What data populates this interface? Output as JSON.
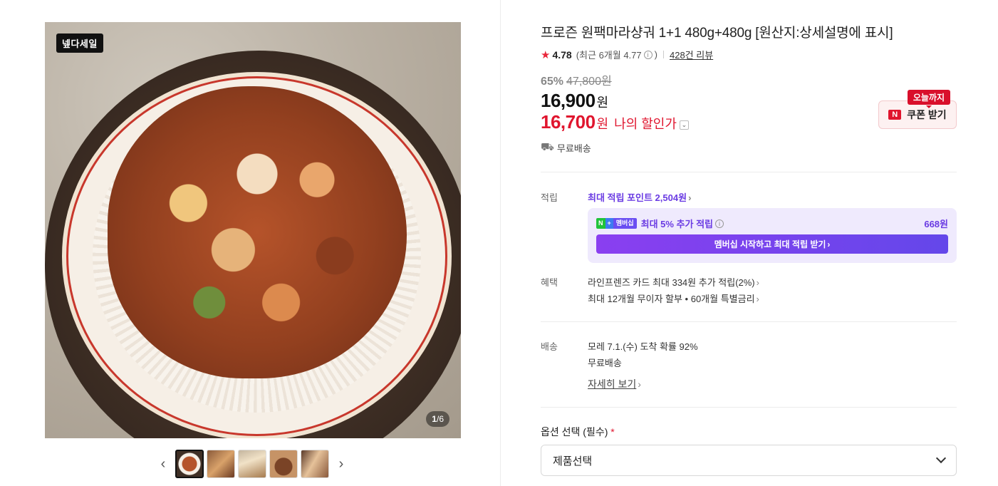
{
  "gallery": {
    "badge": "넾다세일",
    "counter_current": "1",
    "counter_total": "/6",
    "prev_icon": "chevron-left-icon",
    "next_icon": "chevron-right-icon"
  },
  "product": {
    "title": "프로즌 원팩마라샹궈 1+1 480g+480g [원산지:상세설명에 표시]",
    "rating": "4.78",
    "rating_recent": "(최근 6개월 4.77",
    "rating_recent_close": ")",
    "review_count": "428건 리뷰",
    "discount_rate": "65%",
    "original_price": "47,800원",
    "sale_price": "16,900",
    "sale_unit": "원",
    "my_price": "16,700",
    "my_price_unit": "원",
    "my_price_label": "나의 할인가",
    "delivery": "무료배송"
  },
  "coupon": {
    "tag": "오늘까지",
    "label": "쿠폰 받기",
    "logo": "N"
  },
  "points": {
    "label": "적립",
    "title": "최대 적립 포인트 2,504원",
    "membership_logo_text": "멤버십",
    "membership_text": "최대 5% 추가 적립",
    "membership_amount": "668원",
    "membership_button": "멤버십 시작하고 최대 적립 받기"
  },
  "benefits": {
    "label": "혜택",
    "line1": "라인프렌즈 카드 최대 334원 추가 적립(2%)",
    "line2": "최대 12개월 무이자 할부 • 60개월 특별금리"
  },
  "shipping": {
    "label": "배송",
    "line1": "모레 7.1.(수) 도착 확률 92%",
    "line2": "무료배송",
    "detail_link": "자세히 보기"
  },
  "options": {
    "label": "옵션 선택 (필수)",
    "required_mark": "*",
    "select_value": "제품선택"
  },
  "colors": {
    "accent_red": "#e0152e",
    "accent_purple": "#6a3be3"
  }
}
